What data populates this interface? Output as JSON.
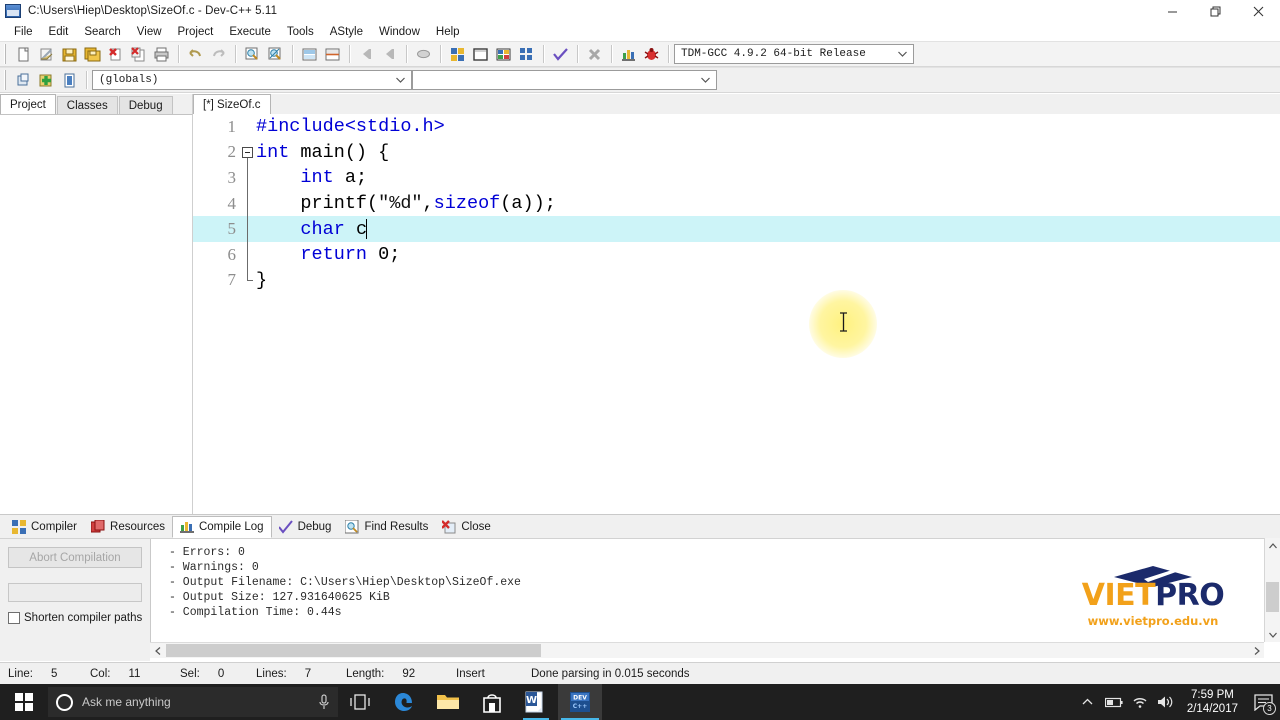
{
  "window": {
    "title": "C:\\Users\\Hiep\\Desktop\\SizeOf.c - Dev-C++ 5.11",
    "app_icon": "devcpp-icon",
    "controls": [
      {
        "name": "minimize-button",
        "icon": "minimize-icon"
      },
      {
        "name": "restore-button",
        "icon": "restore-icon"
      },
      {
        "name": "close-button",
        "icon": "close-icon"
      }
    ]
  },
  "menu": {
    "items": [
      {
        "label": "File"
      },
      {
        "label": "Edit"
      },
      {
        "label": "Search"
      },
      {
        "label": "View"
      },
      {
        "label": "Project"
      },
      {
        "label": "Execute"
      },
      {
        "label": "Tools"
      },
      {
        "label": "AStyle"
      },
      {
        "label": "Window"
      },
      {
        "label": "Help"
      }
    ]
  },
  "toolbar_main": {
    "buttons": [
      {
        "icon": "new-file-icon",
        "title": "New"
      },
      {
        "icon": "open-file-icon",
        "title": "Open"
      },
      {
        "icon": "save-icon",
        "title": "Save"
      },
      {
        "icon": "save-all-icon",
        "title": "Save All"
      },
      {
        "icon": "close-file-icon",
        "title": "Close"
      },
      {
        "icon": "close-all-icon",
        "title": "Close All"
      },
      {
        "icon": "print-icon",
        "title": "Print"
      },
      {
        "icon": "undo-icon",
        "title": "Undo"
      },
      {
        "icon": "redo-icon",
        "title": "Redo"
      },
      {
        "icon": "find-icon",
        "title": "Find"
      },
      {
        "icon": "replace-icon",
        "title": "Replace"
      },
      {
        "icon": "goto-line-icon",
        "title": "Goto Line"
      },
      {
        "icon": "goto-function-icon",
        "title": "Goto Function"
      },
      {
        "icon": "back-icon",
        "title": "Back"
      },
      {
        "icon": "forward-icon",
        "title": "Forward"
      },
      {
        "icon": "toggle-bookmark-icon",
        "title": "Toggle Bookmark"
      },
      {
        "icon": "compile-icon",
        "title": "Compile"
      },
      {
        "icon": "run-icon",
        "title": "Run"
      },
      {
        "icon": "compile-run-icon",
        "title": "Compile & Run"
      },
      {
        "icon": "rebuild-all-icon",
        "title": "Rebuild All"
      },
      {
        "icon": "syntax-check-icon",
        "title": "Syntax Check"
      },
      {
        "icon": "stop-execution-icon",
        "title": "Stop Execution"
      },
      {
        "icon": "profile-icon",
        "title": "Profile Analysis"
      },
      {
        "icon": "debug-icon",
        "title": "Debug"
      }
    ],
    "compiler_select": {
      "value": "TDM-GCC 4.9.2 64-bit Release",
      "icon": "chevron-down-icon"
    }
  },
  "toolbar_secondary": {
    "buttons": [
      {
        "icon": "new-project-icon",
        "title": "New Project"
      },
      {
        "icon": "add-to-project-icon",
        "title": "Add to Project"
      },
      {
        "icon": "remove-from-project-icon",
        "title": "Remove from Project"
      }
    ],
    "scope_select": {
      "value": "(globals)",
      "icon": "chevron-down-icon"
    },
    "member_select": {
      "value": "",
      "icon": "chevron-down-icon"
    }
  },
  "left_panel": {
    "tabs": [
      {
        "label": "Project",
        "active": true
      },
      {
        "label": "Classes",
        "active": false
      },
      {
        "label": "Debug",
        "active": false
      }
    ]
  },
  "editor": {
    "tabs": [
      {
        "label": "[*] SizeOf.c",
        "active": true
      }
    ],
    "lines": [
      {
        "num": "1",
        "fold": "none",
        "highlight": false,
        "tokens": [
          {
            "t": "#include<stdio.h>",
            "c": "pre"
          }
        ]
      },
      {
        "num": "2",
        "fold": "start",
        "highlight": false,
        "tokens": [
          {
            "t": "int",
            "c": "kw"
          },
          {
            "t": " main() {",
            "c": "plain"
          }
        ]
      },
      {
        "num": "3",
        "fold": "mid",
        "highlight": false,
        "tokens": [
          {
            "t": "    ",
            "c": "plain"
          },
          {
            "t": "int",
            "c": "kw"
          },
          {
            "t": " a;",
            "c": "plain"
          }
        ]
      },
      {
        "num": "4",
        "fold": "mid",
        "highlight": false,
        "tokens": [
          {
            "t": "    printf(",
            "c": "plain"
          },
          {
            "t": "\"%d\"",
            "c": "str"
          },
          {
            "t": ",",
            "c": "plain"
          },
          {
            "t": "sizeof",
            "c": "kw"
          },
          {
            "t": "(a));",
            "c": "plain"
          }
        ]
      },
      {
        "num": "5",
        "fold": "mid",
        "highlight": true,
        "caret": true,
        "tokens": [
          {
            "t": "    ",
            "c": "plain"
          },
          {
            "t": "char",
            "c": "kw"
          },
          {
            "t": " c",
            "c": "plain"
          }
        ]
      },
      {
        "num": "6",
        "fold": "mid",
        "highlight": false,
        "tokens": [
          {
            "t": "    ",
            "c": "plain"
          },
          {
            "t": "return",
            "c": "kw"
          },
          {
            "t": " 0;",
            "c": "plain"
          }
        ]
      },
      {
        "num": "7",
        "fold": "end",
        "highlight": false,
        "tokens": [
          {
            "t": "}",
            "c": "plain"
          }
        ]
      }
    ]
  },
  "bottom_tabs": [
    {
      "label": "Compiler",
      "icon": "compiler-icon",
      "active": false
    },
    {
      "label": "Resources",
      "icon": "resources-icon",
      "active": false
    },
    {
      "label": "Compile Log",
      "icon": "compile-log-icon",
      "active": true
    },
    {
      "label": "Debug",
      "icon": "debug-check-icon",
      "active": false
    },
    {
      "label": "Find Results",
      "icon": "find-results-icon",
      "active": false
    },
    {
      "label": "Close",
      "icon": "close-panel-icon",
      "active": false
    }
  ],
  "compile_panel": {
    "abort_button": "Abort Compilation",
    "shorten_label": "Shorten compiler paths",
    "shorten_checked": false,
    "log_lines": [
      "- Errors: 0",
      "- Warnings: 0",
      "- Output Filename: C:\\Users\\Hiep\\Desktop\\SizeOf.exe",
      "- Output Size: 127.931640625 KiB",
      "- Compilation Time: 0.44s"
    ]
  },
  "logo": {
    "name_part1": "VIET",
    "name_part2": "PRO",
    "url": "www.vietpro.edu.vn",
    "color_orange": "#f2a11a",
    "color_navy": "#1b2a6b"
  },
  "status_bar": {
    "line_label": "Line:",
    "line_value": "5",
    "col_label": "Col:",
    "col_value": "11",
    "sel_label": "Sel:",
    "sel_value": "0",
    "lines_label": "Lines:",
    "lines_value": "7",
    "length_label": "Length:",
    "length_value": "92",
    "mode": "Insert",
    "message": "Done parsing in 0.015 seconds"
  },
  "taskbar": {
    "start_icon": "windows-start-icon",
    "search_placeholder": "Ask me anything",
    "mic_icon": "microphone-icon",
    "items": [
      {
        "icon": "task-view-icon",
        "name": "task-view-button",
        "state": "idle"
      },
      {
        "icon": "edge-browser-icon",
        "name": "taskbar-edge",
        "state": "idle"
      },
      {
        "icon": "file-explorer-icon",
        "name": "taskbar-file-explorer",
        "state": "idle"
      },
      {
        "icon": "microsoft-store-icon",
        "name": "taskbar-store",
        "state": "idle"
      },
      {
        "icon": "word-icon",
        "name": "taskbar-word",
        "state": "open"
      },
      {
        "icon": "devcpp-icon",
        "name": "taskbar-devcpp",
        "state": "active"
      }
    ],
    "tray": [
      {
        "icon": "show-hidden-icons-chevron"
      },
      {
        "icon": "battery-icon"
      },
      {
        "icon": "wifi-icon"
      },
      {
        "icon": "volume-icon"
      }
    ],
    "clock_time": "7:59 PM",
    "clock_date": "2/14/2017",
    "notification_icon": "action-center-icon",
    "notification_count": "3"
  }
}
